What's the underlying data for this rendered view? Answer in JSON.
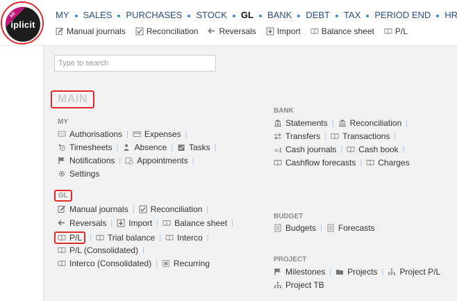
{
  "logo": {
    "word": "iplicit",
    "ribbon": "sit"
  },
  "topnav": [
    "MY",
    "SALES",
    "PURCHASES",
    "STOCK",
    "GL",
    "BANK",
    "DEBT",
    "TAX",
    "PERIOD END",
    "HR"
  ],
  "topnav_active": "GL",
  "subnav": [
    {
      "label": "Manual journals",
      "icon": "journal-icon"
    },
    {
      "label": "Reconciliation",
      "icon": "checkbox-icon"
    },
    {
      "label": "Reversals",
      "icon": "reverse-arrow-icon"
    },
    {
      "label": "Import",
      "icon": "import-icon"
    },
    {
      "label": "Balance sheet",
      "icon": "book-icon"
    },
    {
      "label": "P/L",
      "icon": "book-icon"
    }
  ],
  "search": {
    "placeholder": "Type to search"
  },
  "main_title": "MAIN",
  "sections": {
    "my": {
      "title": "MY",
      "rows": [
        [
          {
            "label": "Authorisations",
            "icon": "chat-icon"
          },
          {
            "label": "Expenses",
            "icon": "card-icon"
          }
        ],
        [
          {
            "label": "Timesheets",
            "icon": "timesheet-icon"
          },
          {
            "label": "Absence",
            "icon": "person-icon"
          },
          {
            "label": "Tasks",
            "icon": "task-icon"
          }
        ],
        [
          {
            "label": "Notifications",
            "icon": "flag-icon"
          },
          {
            "label": "Appointments",
            "icon": "calendar-icon"
          }
        ],
        [
          {
            "label": "Settings",
            "icon": "gear-icon"
          }
        ]
      ]
    },
    "gl": {
      "title": "GL",
      "rows": [
        [
          {
            "label": "Manual journals",
            "icon": "journal-icon"
          },
          {
            "label": "Reconciliation",
            "icon": "checkbox-icon"
          }
        ],
        [
          {
            "label": "Reversals",
            "icon": "reverse-arrow-icon"
          },
          {
            "label": "Import",
            "icon": "import-icon"
          },
          {
            "label": "Balance sheet",
            "icon": "book-icon"
          }
        ],
        [
          {
            "label": "P/L",
            "icon": "book-icon"
          },
          {
            "label": "Trial balance",
            "icon": "book-icon"
          },
          {
            "label": "Interco",
            "icon": "book-icon"
          }
        ],
        [
          {
            "label": "P/L (Consolidated)",
            "icon": "book-icon"
          }
        ],
        [
          {
            "label": "Interco (Consolidated)",
            "icon": "book-icon"
          },
          {
            "label": "Recurring",
            "icon": "recurring-icon"
          }
        ]
      ]
    },
    "bank": {
      "title": "BANK",
      "rows": [
        [
          {
            "label": "Statements",
            "icon": "bank-icon"
          },
          {
            "label": "Reconciliation",
            "icon": "bank-icon"
          }
        ],
        [
          {
            "label": "Transfers",
            "icon": "transfer-icon"
          },
          {
            "label": "Transactions",
            "icon": "book-icon"
          }
        ],
        [
          {
            "label": "Cash journals",
            "icon": "cash-journal-icon"
          },
          {
            "label": "Cash book",
            "icon": "book-icon"
          }
        ],
        [
          {
            "label": "Cashflow forecasts",
            "icon": "book-icon"
          },
          {
            "label": "Charges",
            "icon": "book-icon"
          }
        ]
      ]
    },
    "budget": {
      "title": "BUDGET",
      "rows": [
        [
          {
            "label": "Budgets",
            "icon": "document-icon"
          },
          {
            "label": "Forecasts",
            "icon": "document-icon"
          }
        ]
      ]
    },
    "project": {
      "title": "PROJECT",
      "rows": [
        [
          {
            "label": "Milestones",
            "icon": "flag-icon"
          },
          {
            "label": "Projects",
            "icon": "folder-icon"
          },
          {
            "label": "Project P/L",
            "icon": "hierarchy-icon"
          }
        ],
        [
          {
            "label": "Project TB",
            "icon": "hierarchy-icon"
          }
        ]
      ]
    }
  }
}
